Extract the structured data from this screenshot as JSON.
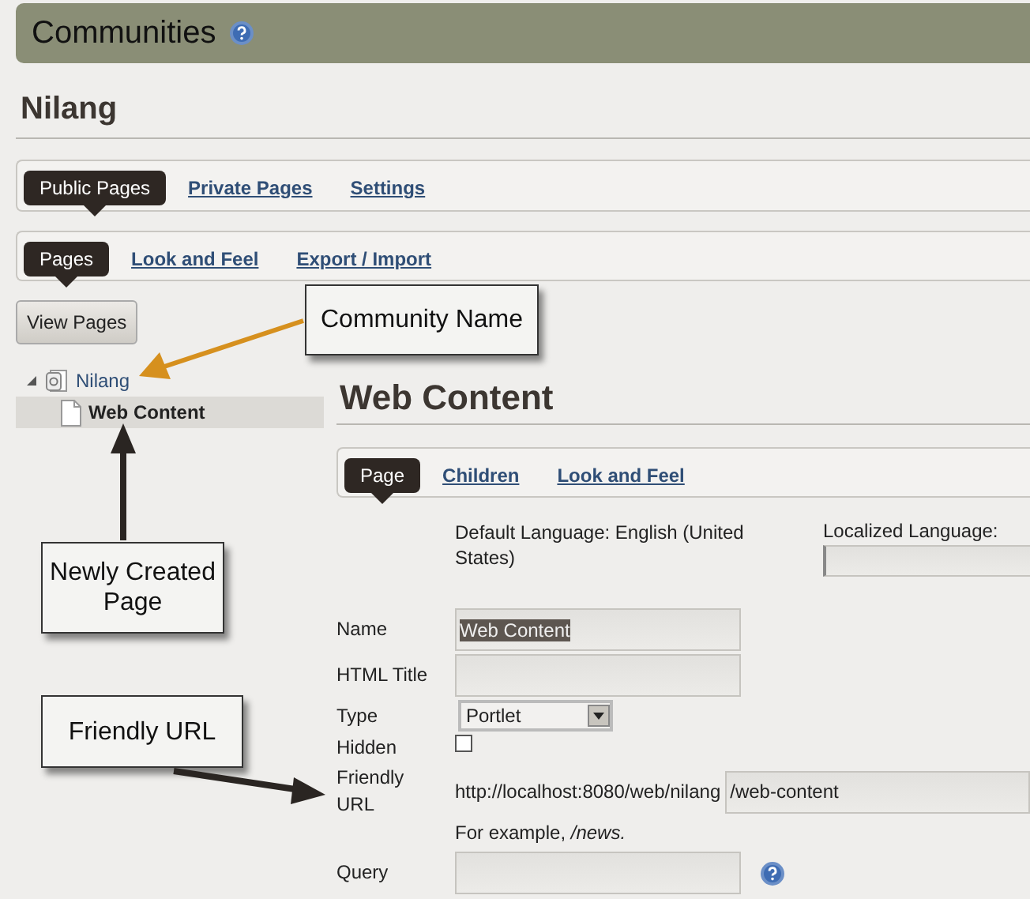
{
  "header": {
    "title": "Communities",
    "help": true
  },
  "community": {
    "name": "Nilang"
  },
  "main_tabs": [
    {
      "label": "Public Pages",
      "selected": true
    },
    {
      "label": "Private Pages",
      "selected": false
    },
    {
      "label": "Settings",
      "selected": false
    }
  ],
  "sub_tabs": [
    {
      "label": "Pages",
      "selected": true
    },
    {
      "label": "Look and Feel",
      "selected": false
    },
    {
      "label": "Export / Import",
      "selected": false
    }
  ],
  "view_pages_button": "View Pages",
  "tree": [
    {
      "label": "Nilang",
      "expanded": true,
      "selected": false,
      "children": [
        {
          "label": "Web Content",
          "selected": true
        }
      ]
    }
  ],
  "page": {
    "title": "Web Content",
    "tabs": [
      {
        "label": "Page",
        "selected": true
      },
      {
        "label": "Children",
        "selected": false
      },
      {
        "label": "Look and Feel",
        "selected": false
      }
    ],
    "default_language": "Default Language: English (United States)",
    "localized_language_label": "Localized Language:",
    "fields": [
      {
        "kind": "text",
        "label": "Name",
        "value": "Web Content",
        "highlighted": true
      },
      {
        "kind": "text",
        "label": "HTML Title"
      },
      {
        "kind": "select",
        "label": "Type",
        "value": "Portlet"
      },
      {
        "kind": "checkbox",
        "label": "Hidden",
        "checked": false
      },
      {
        "kind": "url",
        "label": "Friendly URL",
        "prefix": "http://localhost:8080/web/nilang",
        "value": "/web-content",
        "hint": "For example, */news.*"
      },
      {
        "kind": "text",
        "label": "Query",
        "help": true
      }
    ]
  },
  "callouts": [
    {
      "text": "Community Name"
    },
    {
      "text": "Newly Created Page"
    },
    {
      "text": "Friendly URL"
    }
  ]
}
